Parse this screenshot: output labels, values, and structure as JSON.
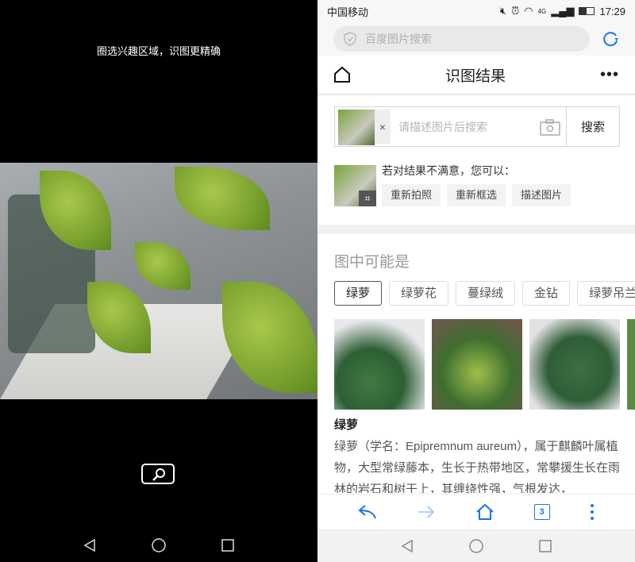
{
  "left": {
    "hint": "圈选兴趣区域，识图更精确"
  },
  "status": {
    "carrier": "中国移动",
    "time": "17:29",
    "network": "4G"
  },
  "address": {
    "placeholder": "百度图片搜索"
  },
  "header": {
    "title": "识图结果"
  },
  "search": {
    "placeholder": "请描述图片后搜索",
    "clear": "×",
    "button": "搜索"
  },
  "suggestion": {
    "question": "若对结果不满意，您可以：",
    "buttons": [
      "重新拍照",
      "重新框选",
      "描述图片"
    ]
  },
  "section": {
    "title": "图中可能是",
    "tags": [
      "绿萝",
      "绿萝花",
      "蔓绿绒",
      "金钻",
      "绿萝吊兰"
    ],
    "selected_tag": "绿萝"
  },
  "result": {
    "name": "绿萝",
    "description": "绿萝（学名：Epipremnum aureum），属于麒麟叶属植物，大型常绿藤本，生长于热带地区，常攀援生长在雨林的岩石和树干上，其缠绕性强，气根发达，"
  },
  "toolbar": {
    "tab_count": "3"
  },
  "colors": {
    "accent": "#1a73e8",
    "forward_disabled": "#9cc4f5"
  }
}
